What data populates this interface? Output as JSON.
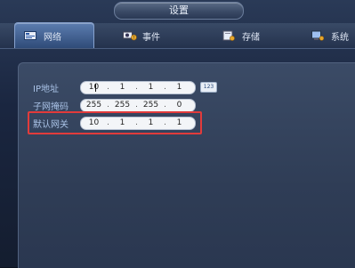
{
  "window": {
    "title": "设置"
  },
  "tabs": [
    {
      "label": "网络",
      "icon": "network-card-icon",
      "active": true
    },
    {
      "label": "事件",
      "icon": "event-camera-icon",
      "active": false
    },
    {
      "label": "存储",
      "icon": "storage-drive-icon",
      "active": false
    },
    {
      "label": "系统",
      "icon": "system-monitor-icon",
      "active": false
    }
  ],
  "network": {
    "ip": {
      "label": "IP地址",
      "octets": [
        "10",
        "1",
        "1",
        "1"
      ],
      "keyboard_badge": "123"
    },
    "subnet": {
      "label": "子网掩码",
      "octets": [
        "255",
        "255",
        "255",
        "0"
      ]
    },
    "gateway": {
      "label": "默认网关",
      "octets": [
        "10",
        "1",
        "1",
        "1"
      ]
    }
  },
  "colors": {
    "highlight_border": "#e23b3b",
    "accent": "#5c7db0"
  }
}
